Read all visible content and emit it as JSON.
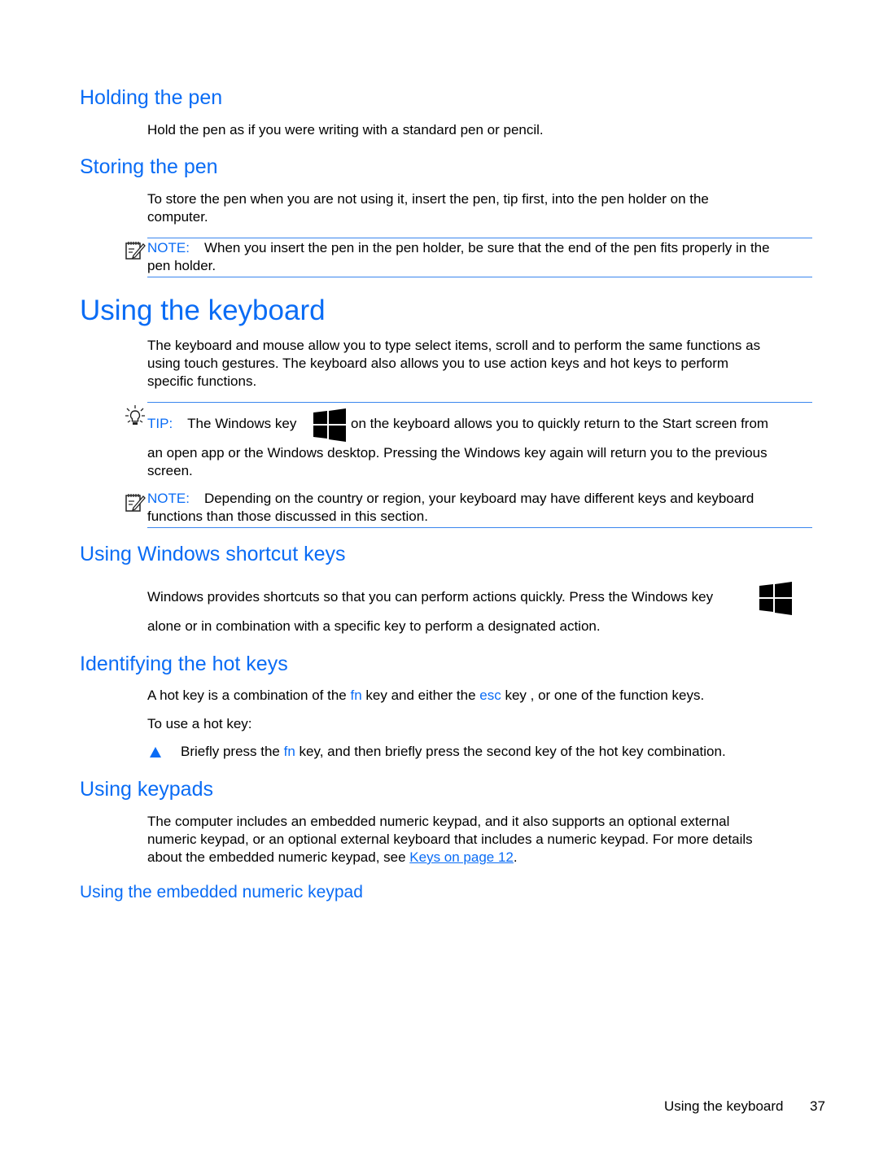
{
  "sections": {
    "holding_pen": {
      "heading": "Holding the pen",
      "body": "Hold the pen as if you were writing with a standard pen or pencil."
    },
    "storing_pen": {
      "heading": "Storing the pen",
      "body_line1": "To store the pen when you are not using it, insert the pen, tip first, into the pen holder on the",
      "body_line2": "computer.",
      "note": {
        "label": "NOTE:",
        "line1": "When you insert the pen in the pen holder, be sure that the end of the pen fits properly in the",
        "line2": "pen holder."
      }
    },
    "using_keyboard": {
      "heading": "Using the keyboard",
      "body_line1": "The keyboard and mouse allow you to type select items, scroll and to perform the same functions as",
      "body_line2": "using touch gestures. The keyboard also allows you to use action keys and hot keys to perform",
      "body_line3": "specific functions.",
      "tip": {
        "label": "TIP:",
        "text_before_icon": "The Windows key",
        "text_after_icon": "on the keyboard allows you to quickly return to the Start screen from",
        "line2": "an open app or the Windows desktop. Pressing the Windows key again will return you to the previous",
        "line3": "screen."
      },
      "note": {
        "label": "NOTE:",
        "line1": "Depending on the country or region, your keyboard may have different keys and keyboard",
        "line2": "functions than those discussed in this section."
      }
    },
    "shortcut_keys": {
      "heading": "Using Windows shortcut keys",
      "line1": "Windows provides shortcuts so that you can perform actions quickly. Press the Windows key",
      "line2": "alone or in combination with a specific key to perform a designated action."
    },
    "hot_keys": {
      "heading": "Identifying the hot keys",
      "line1_a": "A hot key is a combination of the ",
      "line1_fn": "fn",
      "line1_b": " key and either the ",
      "line1_esc": "esc",
      "line1_c": " key , or one of the function keys.",
      "line2": "To use a hot key:",
      "step_a": "Briefly press the ",
      "step_fn": "fn",
      "step_b": " key, and then briefly press the second key of the hot key combination."
    },
    "keypads": {
      "heading": "Using keypads",
      "line1": "The computer includes an embedded numeric keypad, and it also supports an optional external",
      "line2": "numeric keypad, or an optional external keyboard that includes a numeric keypad. For more details",
      "line3_a": "about the embedded numeric keypad, see ",
      "line3_link": "Keys on page 12",
      "line3_b": ".",
      "subheading": "Using the embedded numeric keypad"
    }
  },
  "footer": {
    "section_title": "Using the keyboard",
    "page_number": "37"
  },
  "icons": {
    "note": "note-pencil-icon",
    "tip": "lightbulb-icon",
    "windows_key": "windows-logo-icon",
    "bullet": "triangle-bullet-icon"
  },
  "colors": {
    "accent": "#0a6cf5",
    "text": "#000000",
    "rule": "#3a86ee"
  }
}
